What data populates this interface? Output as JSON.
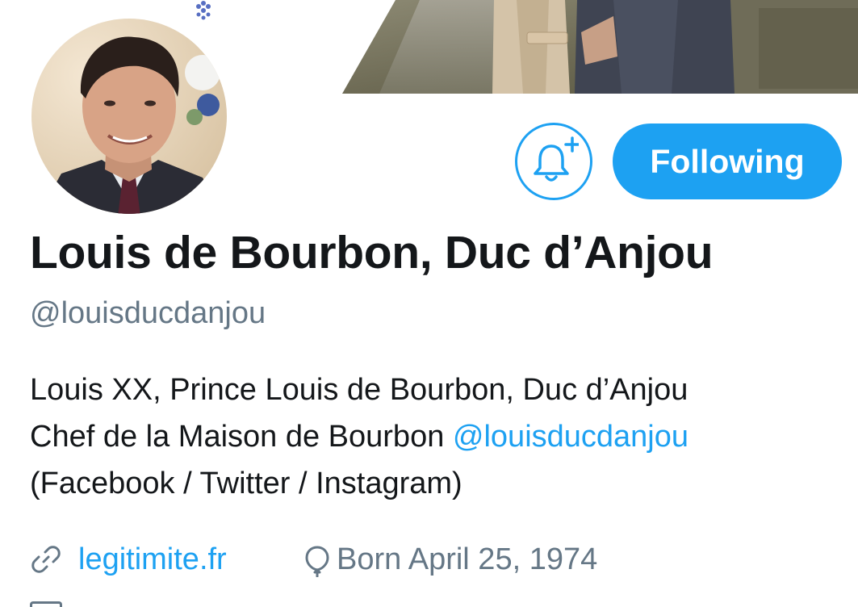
{
  "profile": {
    "display_name": "Louis de Bourbon, Duc d’Anjou",
    "handle": "@louisducdanjou",
    "avatar_icon": "profile-photo",
    "banner_icon": "header-photo"
  },
  "actions": {
    "notify_icon": "bell-plus-icon",
    "following_label": "Following"
  },
  "bio": {
    "line1": "Louis XX, Prince Louis de Bourbon, Duc d’Anjou",
    "line2_text": "Chef de la Maison de Bourbon ",
    "line2_mention": "@louisducdanjou",
    "line3": "(Facebook / Twitter / Instagram)"
  },
  "meta": {
    "link_icon": "link-icon",
    "website": "legitimite.fr",
    "birthday_icon": "balloon-icon",
    "birthday": "Born April 25, 1974"
  },
  "colors": {
    "accent": "#1da1f2",
    "text_primary": "#14171a",
    "text_secondary": "#657786"
  }
}
